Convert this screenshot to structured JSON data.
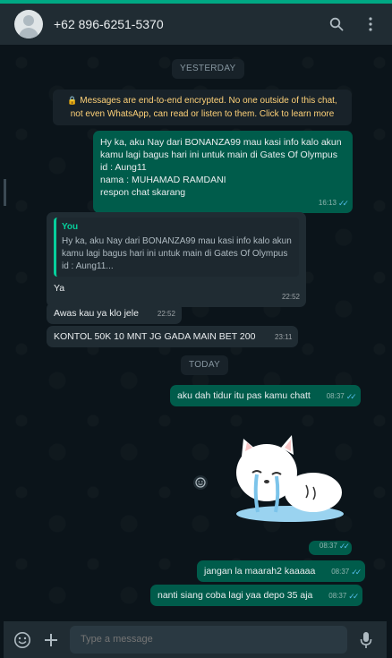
{
  "header": {
    "contact_name": "+62 896-6251-5370",
    "icons": [
      "avatar",
      "search-icon",
      "menu-icon"
    ]
  },
  "chat": {
    "day_yesterday": "YESTERDAY",
    "encryption_notice": "Messages are end-to-end encrypted. No one outside of this chat, not even WhatsApp, can read or listen to them. Click to learn more",
    "messages": [
      {
        "direction": "out",
        "lines": [
          "Hy ka, aku Nay dari BONANZA99 mau kasi info kalo akun kamu lagi bagus hari ini untuk main di Gates Of Olympus id : Aung11",
          "nama : MUHAMAD RAMDANI",
          "respon chat skarang"
        ],
        "time": "16:13",
        "status": "read"
      },
      {
        "direction": "in",
        "quote_author": "You",
        "quote_text": "Hy ka, aku Nay dari BONANZA99 mau kasi info kalo akun kamu lagi bagus hari ini untuk main di Gates Of Olympus id : Aung11...",
        "text": "Ya",
        "time": "22:52"
      },
      {
        "direction": "in",
        "text": "Awas kau ya klo jele",
        "time": "22:52"
      },
      {
        "direction": "in",
        "text": "KONTOL 50K 10 MNT JG GADA MAIN BET 200",
        "time": "23:11"
      }
    ],
    "day_today": "TODAY",
    "today_messages": [
      {
        "direction": "out",
        "text": "aku dah tidur itu pas kamu chatt",
        "time": "08:37",
        "status": "read"
      },
      {
        "direction": "out",
        "type": "sticker",
        "sticker": "crying-white-cat-sticker",
        "time": "08:37",
        "status": "read"
      },
      {
        "direction": "out",
        "text": "jangan la maarah2 kaaaaa",
        "time": "08:37",
        "status": "read"
      },
      {
        "direction": "out",
        "text": "nanti siang coba lagi yaa depo 35 aja",
        "time": "08:37",
        "status": "read"
      }
    ]
  },
  "footer": {
    "placeholder": "Type a message",
    "icons": [
      "emoji-icon",
      "plus-icon",
      "mic-icon"
    ]
  },
  "colors": {
    "outgoing_bubble": "#005c4b",
    "incoming_bubble": "#202c33",
    "background": "#0b141a",
    "accent": "#00a884",
    "read_tick": "#53bdeb"
  }
}
